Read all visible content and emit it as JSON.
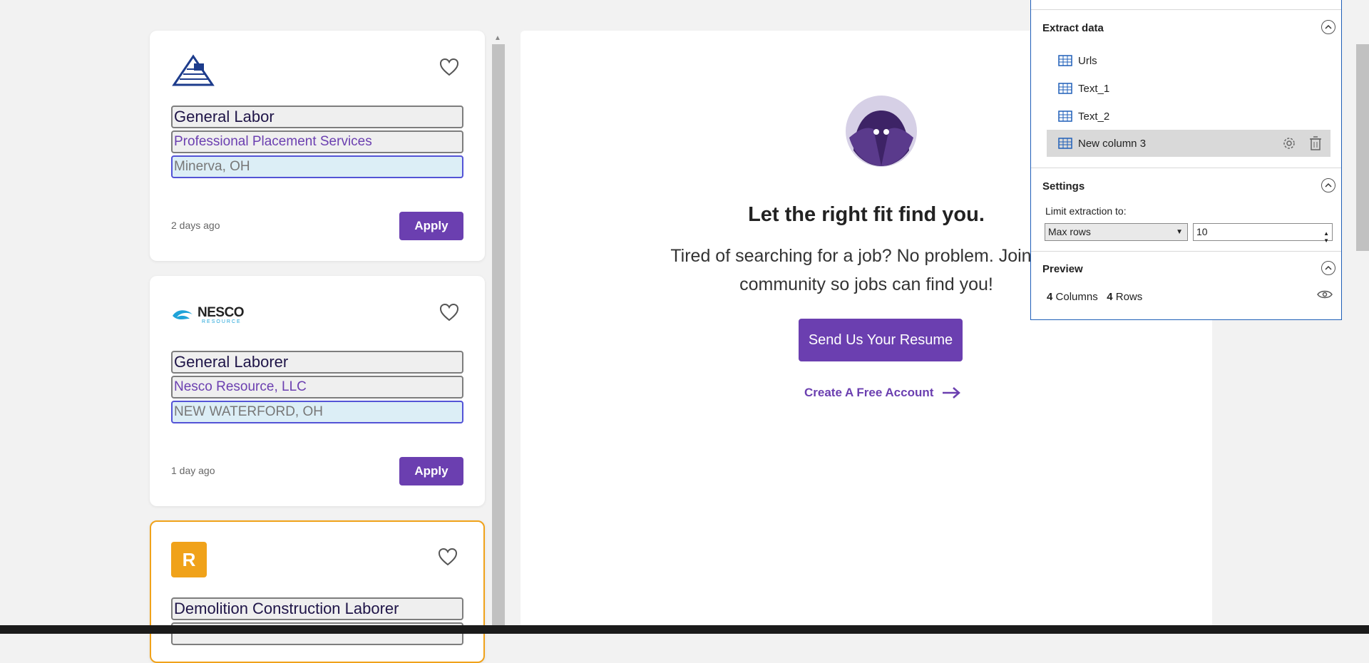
{
  "jobs": [
    {
      "title": "General Labor",
      "company": "Professional Placement Services",
      "location": "Minerva, OH",
      "posted": "2 days ago",
      "apply_label": "Apply",
      "logo": "triangle-flag-logo"
    },
    {
      "title": "General Laborer",
      "company": "Nesco Resource, LLC",
      "location": "NEW WATERFORD, OH",
      "posted": "1 day ago",
      "apply_label": "Apply",
      "logo_text": "NESCO",
      "logo_subtext": "RESOURCE"
    },
    {
      "title": "Demolition Construction Laborer",
      "logo_letter": "R",
      "logo_color": "#f0a21a"
    }
  ],
  "promo": {
    "headline": "Let the right fit find you.",
    "subtext": "Tired of searching for a job? No problem. Join our community so jobs can find you!",
    "resume_button": "Send Us Your Resume",
    "account_link": "Create A Free Account"
  },
  "extract_panel": {
    "extract_heading": "Extract data",
    "columns": [
      "Urls",
      "Text_1",
      "Text_2",
      "New column 3"
    ],
    "active_column": "New column 3",
    "settings_heading": "Settings",
    "limit_label": "Limit extraction to:",
    "limit_mode": "Max rows",
    "limit_value": "10",
    "preview_heading": "Preview",
    "preview_columns": "4",
    "preview_columns_label": "Columns",
    "preview_rows": "4",
    "preview_rows_label": "Rows"
  },
  "colors": {
    "brand_purple": "#6b3fb0",
    "highlight_orange": "#f0a21a",
    "panel_border": "#1f5fb8"
  }
}
